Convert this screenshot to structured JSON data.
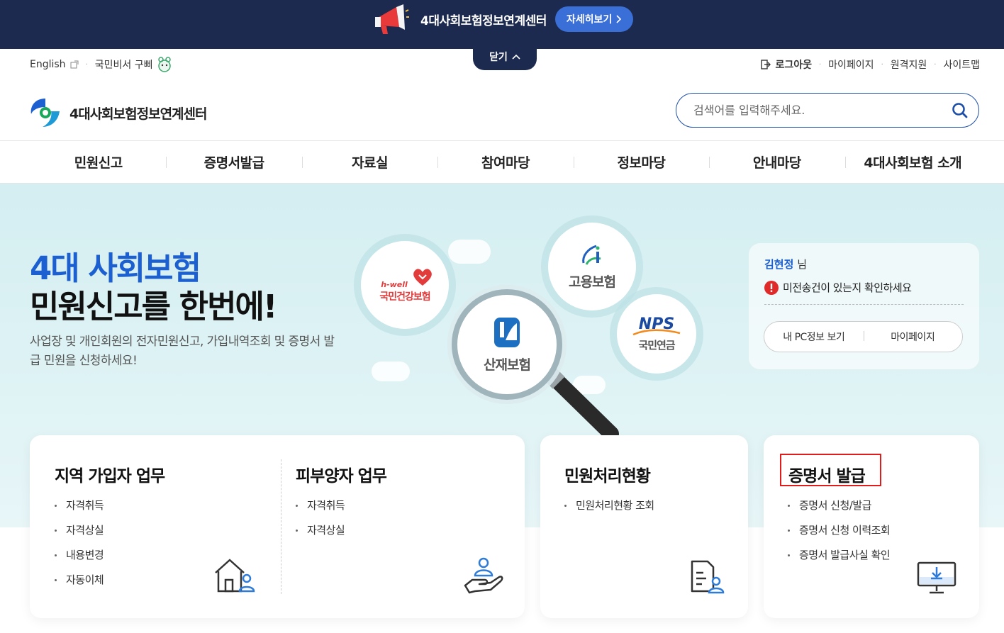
{
  "banner": {
    "text": "4대사회보험정보연계센터",
    "detail_button": "자세히보기",
    "close_label": "닫기"
  },
  "util_left": {
    "english": "English",
    "secretary": "국민비서 구삐"
  },
  "util_right": {
    "logout": "로그아웃",
    "mypage": "마이페이지",
    "remote": "원격지원",
    "sitemap": "사이트맵"
  },
  "logo": {
    "text": "4대사회보험정보연계센터"
  },
  "search": {
    "placeholder": "검색어를 입력해주세요."
  },
  "gnb": [
    {
      "label": "민원신고"
    },
    {
      "label": "증명서발급"
    },
    {
      "label": "자료실"
    },
    {
      "label": "참여마당"
    },
    {
      "label": "정보마당"
    },
    {
      "label": "안내마당"
    },
    {
      "label": "4대사회보험 소개"
    }
  ],
  "hero": {
    "title_line1": "4대 사회보험",
    "title_line2": "민원신고를 한번에!",
    "desc": "사업장 및 개인회원의 전자민원신고, 가입내역조회 및 증명서 발급 민원을 신청하세요!",
    "insurances": {
      "health_brand": "h-well",
      "health": "국민건강보험",
      "employment": "고용보험",
      "industrial": "산재보험",
      "pension_brand": "NPS",
      "pension": "국민연금"
    }
  },
  "user": {
    "name": "김현정",
    "suffix": "님",
    "alert": "미전송건이 있는지 확인하세요",
    "btn_pc": "내 PC정보 보기",
    "btn_mypage": "마이페이지"
  },
  "cards": {
    "regional": {
      "title": "지역 가입자 업무",
      "items": [
        "자격취득",
        "자격상실",
        "내용변경",
        "자동이체"
      ]
    },
    "dependent": {
      "title": "피부양자 업무",
      "items": [
        "자격취득",
        "자격상실"
      ]
    },
    "status": {
      "title": "민원처리현황",
      "items": [
        "민원처리현황 조회"
      ]
    },
    "certificate": {
      "title": "증명서 발급",
      "items": [
        "증명서 신청/발급",
        "증명서 신청 이력조회",
        "증명서 발급사실 확인"
      ]
    }
  },
  "colors": {
    "banner_bg": "#1c2a4f",
    "accent_blue": "#1b5fd0",
    "highlight_red": "#e01d1d"
  }
}
